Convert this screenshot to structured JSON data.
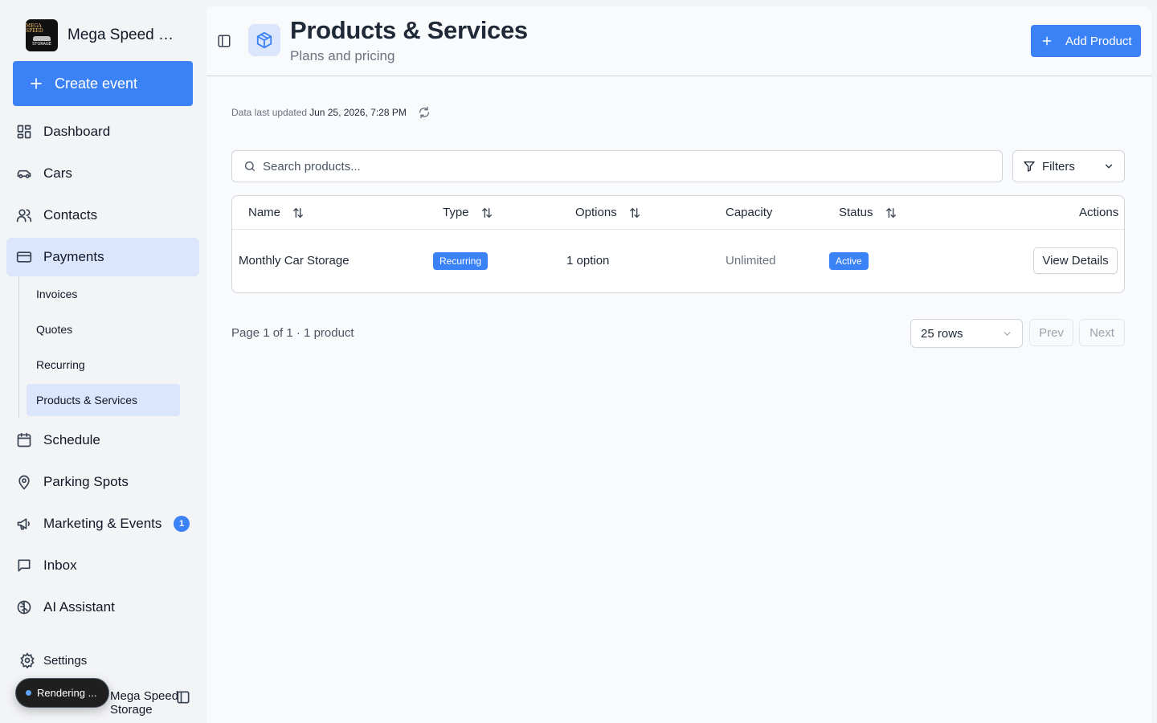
{
  "sidebar": {
    "brand": {
      "name": "Mega Speed Storage",
      "logo_text_top": "MEGA SPEED",
      "logo_text_bottom": "STORAGE"
    },
    "create_button": "Create event",
    "items": [
      {
        "label": "Dashboard",
        "icon": "dashboard-icon"
      },
      {
        "label": "Cars",
        "icon": "car-icon"
      },
      {
        "label": "Contacts",
        "icon": "users-icon"
      },
      {
        "label": "Payments",
        "icon": "credit-card-icon",
        "active": true
      },
      {
        "label": "Schedule",
        "icon": "calendar-icon"
      },
      {
        "label": "Parking Spots",
        "icon": "map-pin-icon"
      },
      {
        "label": "Marketing & Events",
        "icon": "megaphone-icon",
        "badge": "1"
      },
      {
        "label": "Inbox",
        "icon": "message-icon"
      },
      {
        "label": "AI Assistant",
        "icon": "brain-icon"
      }
    ],
    "payments_subitems": [
      {
        "label": "Invoices"
      },
      {
        "label": "Quotes"
      },
      {
        "label": "Recurring"
      },
      {
        "label": "Products & Services",
        "active": true
      }
    ],
    "settings_label": "Settings",
    "footer_user": "Mega Speed Storage",
    "rendering_toast": "Rendering ..."
  },
  "header": {
    "title": "Products & Services",
    "subtitle": "Plans and pricing",
    "add_button": "Add Product"
  },
  "content": {
    "updated_label": "Data last updated",
    "updated_value": "Jun 25, 2026, 7:28 PM",
    "search_placeholder": "Search products...",
    "filters_label": "Filters",
    "table": {
      "columns": [
        "Name",
        "Type",
        "Options",
        "Capacity",
        "Status",
        "Actions"
      ],
      "rows": [
        {
          "name": "Monthly Car Storage",
          "type": "Recurring",
          "options": "1 option",
          "capacity": "Unlimited",
          "status": "Active",
          "action": "View Details"
        }
      ]
    },
    "pagination": {
      "info": "Page 1 of 1 · 1 product",
      "rows_per_page": "25 rows",
      "prev": "Prev",
      "next": "Next"
    }
  },
  "colors": {
    "accent": "#3b82f6",
    "active_bg": "#dbe5fc",
    "sidebar_bg": "#f3f4f6"
  }
}
